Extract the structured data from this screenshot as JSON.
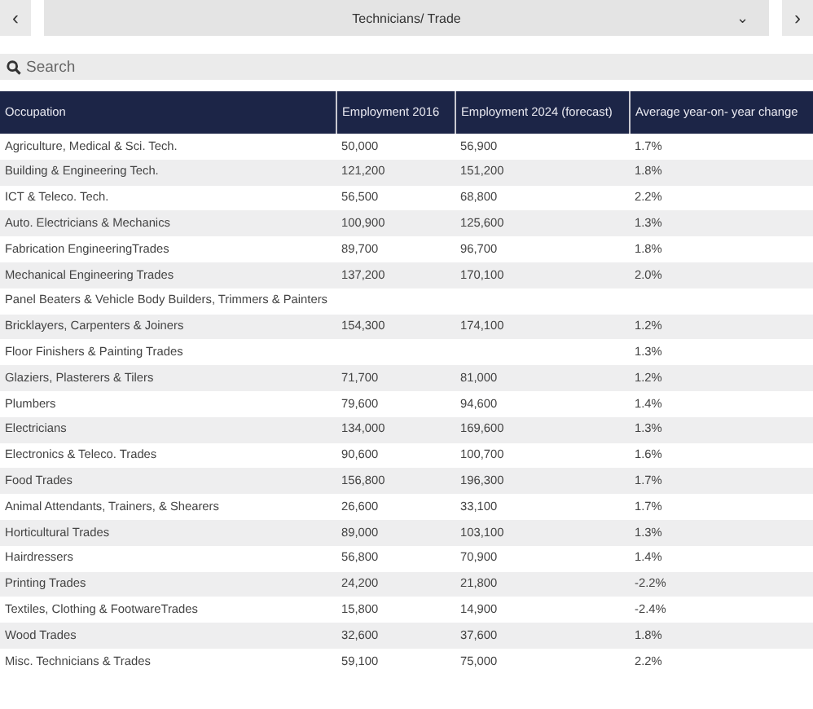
{
  "nav": {
    "prev": "‹",
    "title": "Technicians/ Trade",
    "caret": "⌄",
    "next": "›"
  },
  "search": {
    "placeholder": "Search"
  },
  "table": {
    "columns": [
      "Occupation",
      "Employment 2016",
      "Employment 2024 (forecast)",
      "Average year-on- year change"
    ],
    "rows": [
      {
        "occupation": "Agriculture, Medical & Sci. Tech.",
        "e2016": "50,000",
        "e2024": "56,900",
        "change": "1.7%"
      },
      {
        "occupation": "Building & Engineering Tech.",
        "e2016": "121,200",
        "e2024": "151,200",
        "change": "1.8%"
      },
      {
        "occupation": "ICT & Teleco. Tech.",
        "e2016": "56,500",
        "e2024": "68,800",
        "change": "2.2%"
      },
      {
        "occupation": "Auto. Electricians & Mechanics",
        "e2016": "100,900",
        "e2024": "125,600",
        "change": "1.3%"
      },
      {
        "occupation": "Fabrication EngineeringTrades",
        "e2016": "89,700",
        "e2024": "96,700",
        "change": "1.8%"
      },
      {
        "occupation": "Mechanical Engineering Trades",
        "e2016": "137,200",
        "e2024": "170,100",
        "change": "2.0%"
      },
      {
        "occupation": "Panel Beaters & Vehicle Body Builders, Trimmers & Painters"
      },
      {
        "occupation": "Bricklayers, Carpenters & Joiners",
        "e2016": "154,300",
        "e2024": "174,100",
        "change": "1.2%"
      },
      {
        "occupation": "Floor Finishers & Painting Trades",
        "change": "1.3%"
      },
      {
        "occupation": "Glaziers, Plasterers & Tilers",
        "e2016": "71,700",
        "e2024": "81,000",
        "change": "1.2%"
      },
      {
        "occupation": "Plumbers",
        "e2016": "79,600",
        "e2024": "94,600",
        "change": "1.4%"
      },
      {
        "occupation": "Electricians",
        "e2016": "134,000",
        "e2024": "169,600",
        "change": "1.3%"
      },
      {
        "occupation": "Electronics & Teleco. Trades",
        "e2016": "90,600",
        "e2024": "100,700",
        "change": "1.6%"
      },
      {
        "occupation": "Food Trades",
        "e2016": "156,800",
        "e2024": "196,300",
        "change": "1.7%"
      },
      {
        "occupation": "Animal Attendants, Trainers, & Shearers",
        "e2016": "26,600",
        "e2024": "33,100",
        "change": "1.7%"
      },
      {
        "occupation": "Horticultural Trades",
        "e2016": "89,000",
        "e2024": "103,100",
        "change": "1.3%"
      },
      {
        "occupation": "Hairdressers",
        "e2016": "56,800",
        "e2024": "70,900",
        "change": "1.4%"
      },
      {
        "occupation": "Printing Trades",
        "e2016": "24,200",
        "e2024": "21,800",
        "change": "-2.2%"
      },
      {
        "occupation": "Textiles, Clothing & FootwareTrades",
        "e2016": "15,800",
        "e2024": "14,900",
        "change": "-2.4%"
      },
      {
        "occupation": "Wood Trades",
        "e2016": "32,600",
        "e2024": "37,600",
        "change": "1.8%"
      },
      {
        "occupation": "Misc. Technicians & Trades",
        "e2016": "59,100",
        "e2024": "75,000",
        "change": "2.2%"
      }
    ]
  }
}
